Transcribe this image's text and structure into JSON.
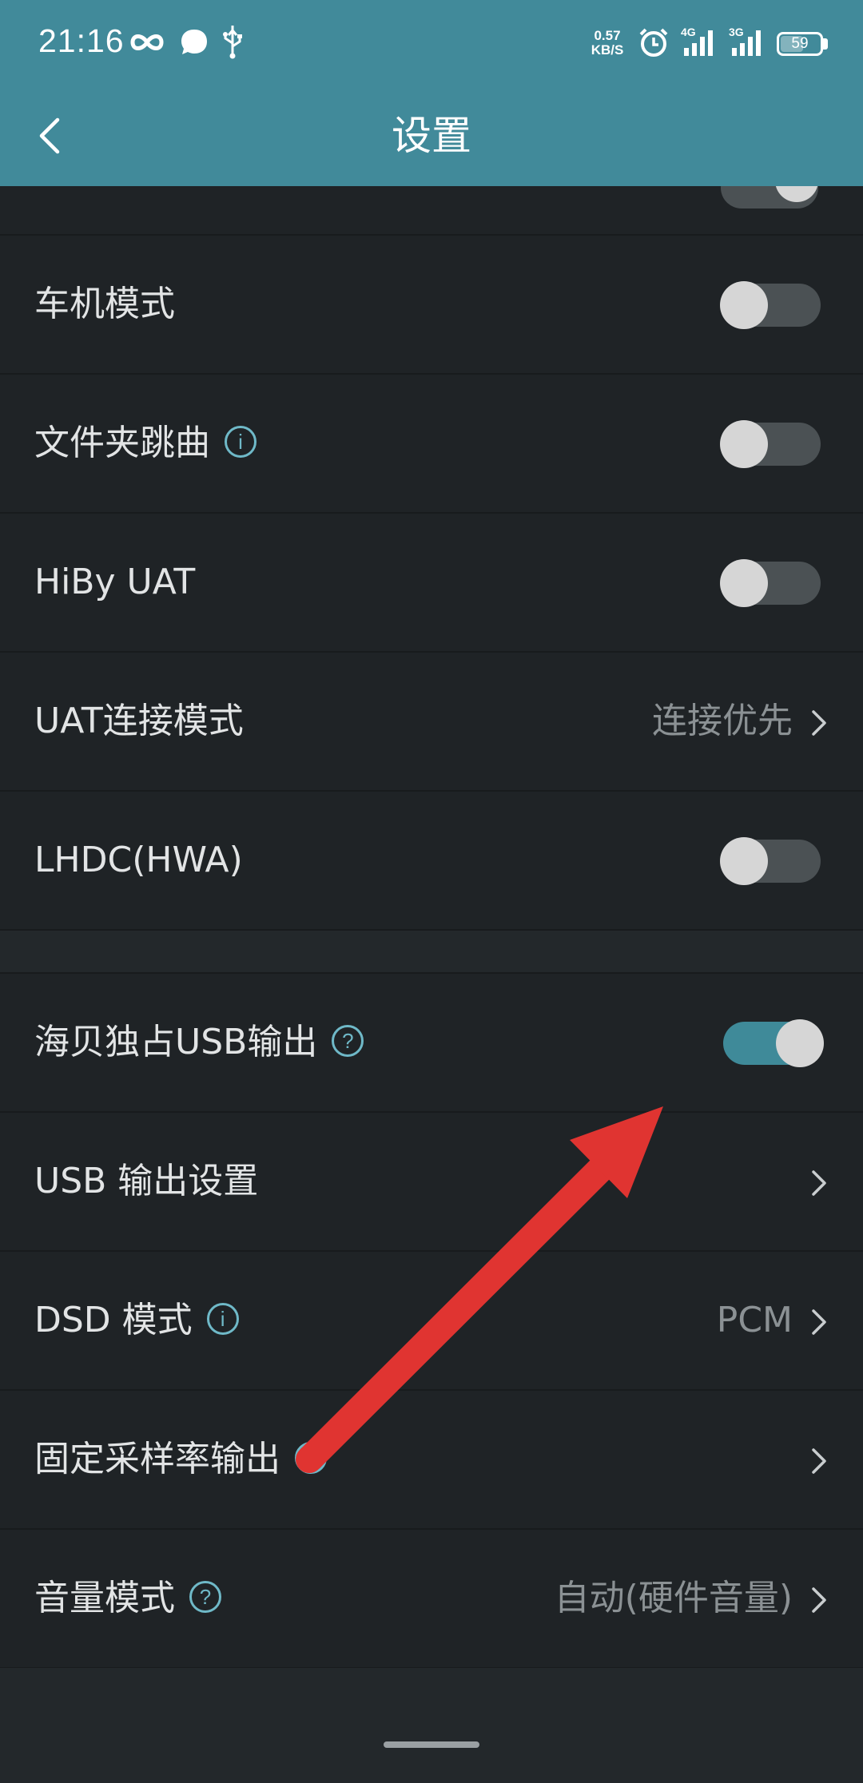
{
  "status_bar": {
    "time": "21:16",
    "net_speed_value": "0.57",
    "net_speed_unit": "KB/S",
    "signal1": "4G",
    "signal2": "3G",
    "battery": "59",
    "battery_level": 0.59
  },
  "app_bar": {
    "title": "设置"
  },
  "rows": [
    {
      "label": "车机模式",
      "control": "toggle",
      "on": false
    },
    {
      "label": "文件夹跳曲",
      "icon": "info",
      "icon_text": "i",
      "control": "toggle",
      "on": false
    },
    {
      "label": "HiBy UAT",
      "control": "toggle",
      "on": false
    },
    {
      "label": "UAT连接模式",
      "value": "连接优先",
      "control": "chevron"
    },
    {
      "label": "LHDC(HWA)",
      "control": "toggle",
      "on": false
    }
  ],
  "rows2": [
    {
      "label": "海贝独占USB输出",
      "icon": "help",
      "icon_text": "?",
      "control": "toggle",
      "on": true
    },
    {
      "label": "USB 输出设置",
      "control": "chevron"
    },
    {
      "label": "DSD 模式",
      "icon": "info",
      "icon_text": "i",
      "value": "PCM",
      "control": "chevron"
    },
    {
      "label": "固定采样率输出",
      "icon": "help",
      "icon_text": "?",
      "control": "chevron"
    },
    {
      "label": "音量模式",
      "icon": "help",
      "icon_text": "?",
      "value": "自动(硬件音量)",
      "control": "chevron"
    }
  ],
  "colors": {
    "header": "#418a9a",
    "background": "#1f2326",
    "toggle_on": "#3f8a99",
    "accent_icon": "#6fb9c8",
    "arrow": "#e03431"
  }
}
